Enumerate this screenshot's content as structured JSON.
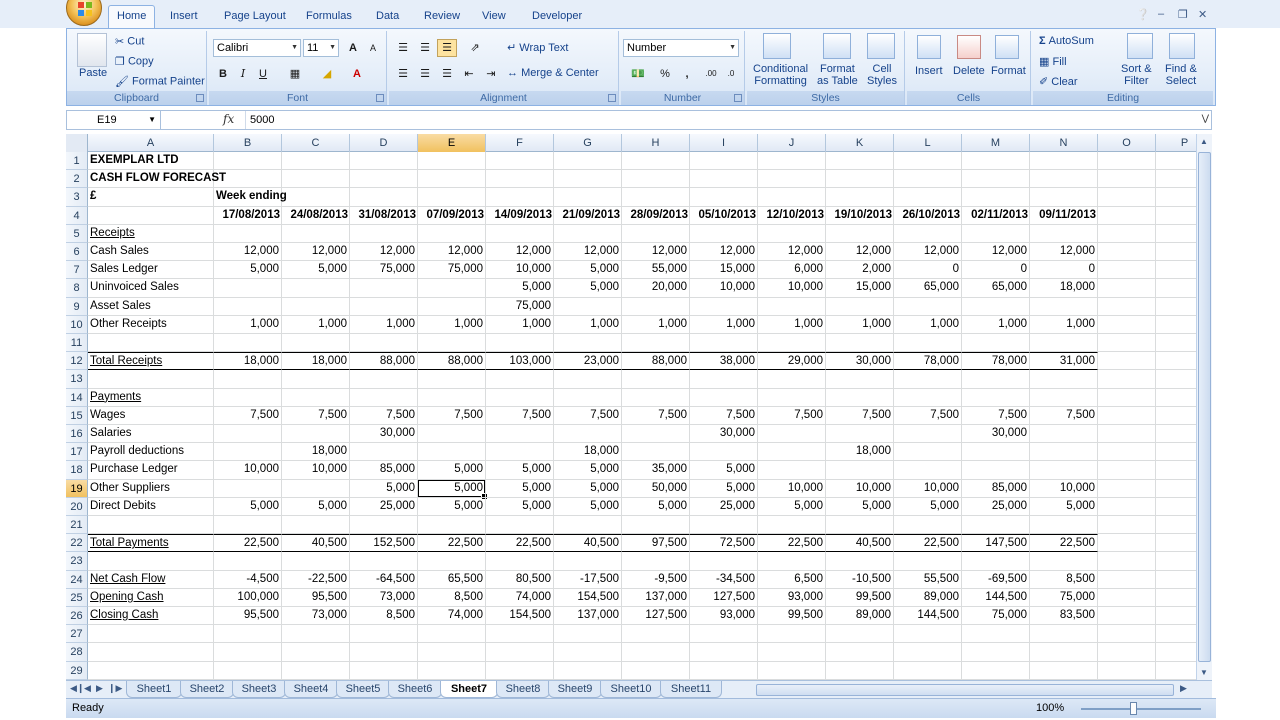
{
  "tabs": [
    "Home",
    "Insert",
    "Page Layout",
    "Formulas",
    "Data",
    "Review",
    "View",
    "Developer"
  ],
  "active_tab": "Home",
  "ribbon": {
    "clipboard": {
      "paste": "Paste",
      "cut": "Cut",
      "copy": "Copy",
      "format_painter": "Format Painter",
      "label": "Clipboard"
    },
    "font": {
      "name": "Calibri",
      "size": "11",
      "bold": "B",
      "italic": "I",
      "underline": "U",
      "label": "Font",
      "grow": "A",
      "shrink": "A"
    },
    "alignment": {
      "wrap": "Wrap Text",
      "merge": "Merge & Center",
      "label": "Alignment"
    },
    "number": {
      "format": "Number",
      "percent": "%",
      "comma": ",",
      "label": "Number",
      "inc": ".00",
      "dec": ".0"
    },
    "styles": {
      "conditional": "Conditional",
      "conditional2": "Formatting",
      "format_table": "Format",
      "format_table2": "as Table",
      "cell_styles": "Cell",
      "cell_styles2": "Styles",
      "label": "Styles"
    },
    "cells": {
      "insert": "Insert",
      "delete": "Delete",
      "format": "Format",
      "label": "Cells"
    },
    "editing": {
      "autosum": "AutoSum",
      "fill": "Fill",
      "clear": "Clear",
      "sort": "Sort &",
      "sort2": "Filter",
      "find": "Find &",
      "find2": "Select",
      "label": "Editing"
    }
  },
  "formula_bar": {
    "name_box": "E19",
    "fx": "fx",
    "content": "5000"
  },
  "columns": [
    "A",
    "B",
    "C",
    "D",
    "E",
    "F",
    "G",
    "H",
    "I",
    "J",
    "K",
    "L",
    "M",
    "N",
    "O",
    "P"
  ],
  "selected_column": "E",
  "selected_row": "19",
  "rows": [
    {
      "n": "1",
      "a": "EXEMPLAR LTD",
      "bold": true
    },
    {
      "n": "2",
      "a": "CASH FLOW FORECAST",
      "bold": true
    },
    {
      "n": "3",
      "a": "£",
      "bold": true,
      "b": "Week ending"
    },
    {
      "n": "4",
      "dates": [
        "17/08/2013",
        "24/08/2013",
        "31/08/2013",
        "07/09/2013",
        "14/09/2013",
        "21/09/2013",
        "28/09/2013",
        "05/10/2013",
        "12/10/2013",
        "19/10/2013",
        "26/10/2013",
        "02/11/2013",
        "09/11/2013"
      ]
    },
    {
      "n": "5",
      "a": "Receipts",
      "underline": true
    },
    {
      "n": "6",
      "a": "Cash Sales",
      "v": [
        "12,000",
        "12,000",
        "12,000",
        "12,000",
        "12,000",
        "12,000",
        "12,000",
        "12,000",
        "12,000",
        "12,000",
        "12,000",
        "12,000",
        "12,000"
      ]
    },
    {
      "n": "7",
      "a": "Sales Ledger",
      "v": [
        "5,000",
        "5,000",
        "75,000",
        "75,000",
        "10,000",
        "5,000",
        "55,000",
        "15,000",
        "6,000",
        "2,000",
        "0",
        "0",
        "0"
      ]
    },
    {
      "n": "8",
      "a": "Uninvoiced Sales",
      "v": [
        "",
        "",
        "",
        "",
        "5,000",
        "5,000",
        "20,000",
        "10,000",
        "10,000",
        "15,000",
        "65,000",
        "65,000",
        "18,000"
      ]
    },
    {
      "n": "9",
      "a": "Asset Sales",
      "v": [
        "",
        "",
        "",
        "",
        "75,000",
        "",
        "",
        "",
        "",
        "",
        "",
        "",
        ""
      ]
    },
    {
      "n": "10",
      "a": "Other Receipts",
      "v": [
        "1,000",
        "1,000",
        "1,000",
        "1,000",
        "1,000",
        "1,000",
        "1,000",
        "1,000",
        "1,000",
        "1,000",
        "1,000",
        "1,000",
        "1,000"
      ]
    },
    {
      "n": "11"
    },
    {
      "n": "12",
      "a": "Total Receipts",
      "underline": true,
      "total": true,
      "v": [
        "18,000",
        "18,000",
        "88,000",
        "88,000",
        "103,000",
        "23,000",
        "88,000",
        "38,000",
        "29,000",
        "30,000",
        "78,000",
        "78,000",
        "31,000"
      ]
    },
    {
      "n": "13"
    },
    {
      "n": "14",
      "a": "Payments",
      "underline": true
    },
    {
      "n": "15",
      "a": "Wages",
      "v": [
        "7,500",
        "7,500",
        "7,500",
        "7,500",
        "7,500",
        "7,500",
        "7,500",
        "7,500",
        "7,500",
        "7,500",
        "7,500",
        "7,500",
        "7,500"
      ]
    },
    {
      "n": "16",
      "a": "Salaries",
      "v": [
        "",
        "",
        "30,000",
        "",
        "",
        "",
        "",
        "30,000",
        "",
        "",
        "",
        "30,000",
        ""
      ]
    },
    {
      "n": "17",
      "a": "Payroll deductions",
      "v": [
        "",
        "18,000",
        "",
        "",
        "",
        "18,000",
        "",
        "",
        "",
        "18,000",
        "",
        "",
        ""
      ]
    },
    {
      "n": "18",
      "a": "Purchase Ledger",
      "v": [
        "10,000",
        "10,000",
        "85,000",
        "5,000",
        "5,000",
        "5,000",
        "35,000",
        "5,000",
        "",
        "",
        "",
        "",
        ""
      ]
    },
    {
      "n": "19",
      "a": "Other Suppliers",
      "v": [
        "",
        "",
        "5,000",
        "5,000",
        "5,000",
        "5,000",
        "50,000",
        "5,000",
        "10,000",
        "10,000",
        "10,000",
        "85,000",
        "10,000"
      ]
    },
    {
      "n": "20",
      "a": "Direct Debits",
      "v": [
        "5,000",
        "5,000",
        "25,000",
        "5,000",
        "5,000",
        "5,000",
        "5,000",
        "25,000",
        "5,000",
        "5,000",
        "5,000",
        "25,000",
        "5,000"
      ]
    },
    {
      "n": "21"
    },
    {
      "n": "22",
      "a": "Total Payments",
      "underline": true,
      "total": true,
      "v": [
        "22,500",
        "40,500",
        "152,500",
        "22,500",
        "22,500",
        "40,500",
        "97,500",
        "72,500",
        "22,500",
        "40,500",
        "22,500",
        "147,500",
        "22,500"
      ]
    },
    {
      "n": "23"
    },
    {
      "n": "24",
      "a": "Net Cash Flow",
      "underline": true,
      "v": [
        "-4,500",
        "-22,500",
        "-64,500",
        "65,500",
        "80,500",
        "-17,500",
        "-9,500",
        "-34,500",
        "6,500",
        "-10,500",
        "55,500",
        "-69,500",
        "8,500"
      ]
    },
    {
      "n": "25",
      "a": "Opening Cash",
      "underline": true,
      "v": [
        "100,000",
        "95,500",
        "73,000",
        "8,500",
        "74,000",
        "154,500",
        "137,000",
        "127,500",
        "93,000",
        "99,500",
        "89,000",
        "144,500",
        "75,000"
      ]
    },
    {
      "n": "26",
      "a": "Closing Cash",
      "underline": true,
      "v": [
        "95,500",
        "73,000",
        "8,500",
        "74,000",
        "154,500",
        "137,000",
        "127,500",
        "93,000",
        "99,500",
        "89,000",
        "144,500",
        "75,000",
        "83,500"
      ]
    },
    {
      "n": "27"
    },
    {
      "n": "28"
    },
    {
      "n": "29"
    }
  ],
  "sheets": [
    "Sheet1",
    "Sheet2",
    "Sheet3",
    "Sheet4",
    "Sheet5",
    "Sheet6",
    "Sheet7",
    "Sheet8",
    "Sheet9",
    "Sheet10",
    "Sheet11"
  ],
  "active_sheet": "Sheet7",
  "status": {
    "ready": "Ready",
    "zoom": "100%"
  },
  "colors": {
    "accent": "#15428b",
    "selected_header": "#f1c15f"
  },
  "icons": [
    "office-button-icon",
    "help-icon",
    "minimize-icon",
    "restore-icon",
    "close-icon",
    "cut-icon",
    "copy-icon",
    "format-painter-icon",
    "autosum-icon",
    "fill-icon",
    "clear-icon"
  ]
}
